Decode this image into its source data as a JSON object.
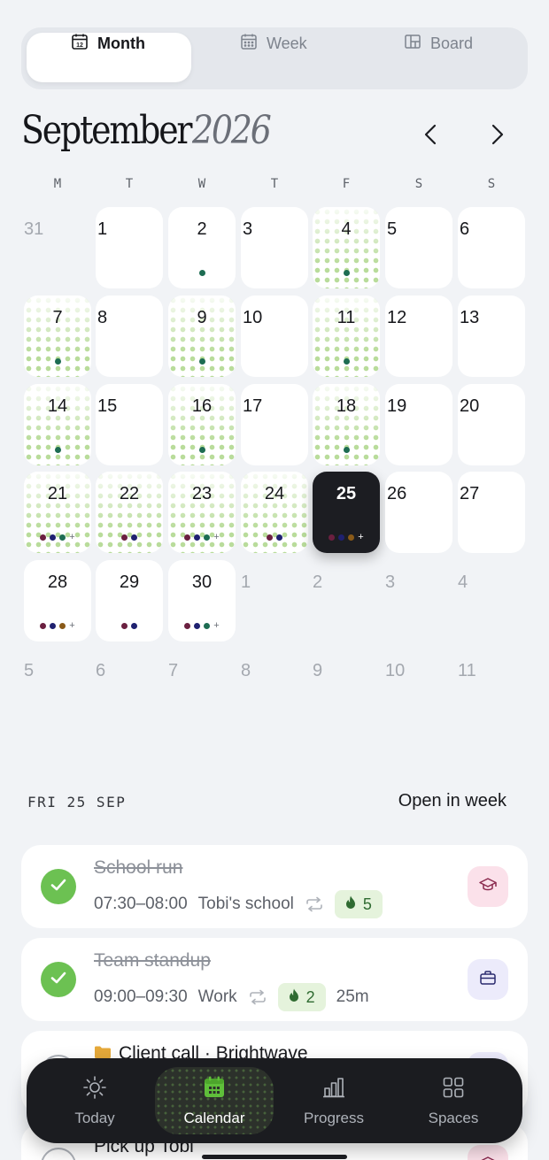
{
  "view_switcher": {
    "tabs": [
      {
        "label": "Month",
        "icon": "calendar-12-icon",
        "active": true
      },
      {
        "label": "Week",
        "icon": "calendar-grid-icon",
        "active": false
      },
      {
        "label": "Board",
        "icon": "board-icon",
        "active": false
      }
    ]
  },
  "header": {
    "month": "September",
    "year": "2026",
    "prev_icon": "chevron-left-icon",
    "next_icon": "chevron-right-icon"
  },
  "weekdays": [
    "M",
    "T",
    "W",
    "T",
    "F",
    "S",
    "S"
  ],
  "colors": {
    "plum": "#6b2040",
    "navy": "#1f2170",
    "teal": "#1d6c52",
    "brown": "#8a5a18",
    "green_check": "#6cc152",
    "accent_green": "#5fbf3a"
  },
  "calendar": {
    "weeks": [
      [
        {
          "n": "31",
          "muted": true
        },
        {
          "n": "1",
          "bg": "white",
          "align": "left"
        },
        {
          "n": "2",
          "bg": "white",
          "dots": [
            "teal"
          ]
        },
        {
          "n": "3",
          "bg": "white",
          "align": "left"
        },
        {
          "n": "4",
          "bg": "dots",
          "dots": [
            "teal"
          ]
        },
        {
          "n": "5",
          "bg": "white",
          "align": "left"
        },
        {
          "n": "6",
          "bg": "white",
          "align": "left"
        }
      ],
      [
        {
          "n": "7",
          "bg": "dots",
          "dots": [
            "teal"
          ]
        },
        {
          "n": "8",
          "bg": "white",
          "align": "left"
        },
        {
          "n": "9",
          "bg": "dots",
          "dots": [
            "teal"
          ]
        },
        {
          "n": "10",
          "bg": "white",
          "align": "left"
        },
        {
          "n": "11",
          "bg": "dots",
          "dots": [
            "teal"
          ]
        },
        {
          "n": "12",
          "bg": "white",
          "align": "left"
        },
        {
          "n": "13",
          "bg": "white",
          "align": "left"
        }
      ],
      [
        {
          "n": "14",
          "bg": "dots",
          "dots": [
            "teal"
          ]
        },
        {
          "n": "15",
          "bg": "white",
          "align": "left"
        },
        {
          "n": "16",
          "bg": "dots",
          "dots": [
            "teal"
          ]
        },
        {
          "n": "17",
          "bg": "white",
          "align": "left"
        },
        {
          "n": "18",
          "bg": "dots",
          "dots": [
            "teal"
          ]
        },
        {
          "n": "19",
          "bg": "white",
          "align": "left"
        },
        {
          "n": "20",
          "bg": "white",
          "align": "left"
        }
      ],
      [
        {
          "n": "21",
          "bg": "dots",
          "dots": [
            "plum",
            "navy",
            "teal"
          ],
          "more": true
        },
        {
          "n": "22",
          "bg": "dots",
          "dots": [
            "plum",
            "navy"
          ]
        },
        {
          "n": "23",
          "bg": "dots",
          "dots": [
            "plum",
            "navy",
            "teal"
          ],
          "more": true
        },
        {
          "n": "24",
          "bg": "dots",
          "dots": [
            "plum",
            "navy"
          ]
        },
        {
          "n": "25",
          "bg": "dark",
          "dots": [
            "plum",
            "navy",
            "brown"
          ],
          "more": true,
          "selected": true
        },
        {
          "n": "26",
          "bg": "white",
          "align": "left"
        },
        {
          "n": "27",
          "bg": "white",
          "align": "left"
        }
      ],
      [
        {
          "n": "28",
          "bg": "white",
          "dots": [
            "plum",
            "navy",
            "brown"
          ],
          "more": true
        },
        {
          "n": "29",
          "bg": "white",
          "dots": [
            "plum",
            "navy"
          ]
        },
        {
          "n": "30",
          "bg": "white",
          "dots": [
            "plum",
            "navy",
            "teal"
          ],
          "more": true
        },
        {
          "n": "1",
          "muted": true
        },
        {
          "n": "2",
          "muted": true
        },
        {
          "n": "3",
          "muted": true
        },
        {
          "n": "4",
          "muted": true
        }
      ],
      [
        {
          "n": "5",
          "muted": true
        },
        {
          "n": "6",
          "muted": true
        },
        {
          "n": "7",
          "muted": true
        },
        {
          "n": "8",
          "muted": true
        },
        {
          "n": "9",
          "muted": true
        },
        {
          "n": "10",
          "muted": true
        },
        {
          "n": "11",
          "muted": true
        }
      ]
    ]
  },
  "selected_day": {
    "label": "FRI 25 SEP",
    "open_in_week": "Open in week"
  },
  "tasks": [
    {
      "title": "School run",
      "time": "07:30–08:00",
      "space": "Tobi's school",
      "repeat": true,
      "streak": "5",
      "done": true,
      "icon": "graduation-cap-icon"
    },
    {
      "title": "Team standup",
      "time": "09:00–09:30",
      "space": "Work",
      "repeat": true,
      "streak": "2",
      "duration": "25m",
      "done": true,
      "icon": "briefcase-icon"
    },
    {
      "title": "Client call · Brightwave",
      "done": false,
      "icon": "briefcase-icon"
    },
    {
      "title": "Pick up Tobi",
      "done": false,
      "icon": "graduation-cap-icon"
    }
  ],
  "bottom_nav": [
    {
      "label": "Today",
      "icon": "sun-icon",
      "active": false
    },
    {
      "label": "Calendar",
      "icon": "calendar-icon",
      "active": true
    },
    {
      "label": "Progress",
      "icon": "bar-chart-icon",
      "active": false
    },
    {
      "label": "Spaces",
      "icon": "grid-icon",
      "active": false
    }
  ]
}
